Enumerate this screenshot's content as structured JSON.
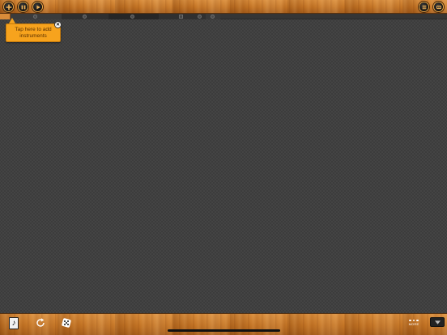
{
  "toolbar": {
    "left_buttons": [
      {
        "icon": "add-icon"
      },
      {
        "icon": "pause-icon"
      },
      {
        "icon": "play-icon"
      }
    ],
    "right_buttons": [
      {
        "icon": "menu-icon"
      },
      {
        "icon": "settings-icon"
      }
    ],
    "accent_color": "#f0b45a"
  },
  "tooltip": {
    "text": "Tap here to add instruments",
    "close_glyph": "✕",
    "background_color": "#f7a31d"
  },
  "bottom_toolbar": {
    "note_glyph": "♪",
    "more_label": "MORE"
  }
}
